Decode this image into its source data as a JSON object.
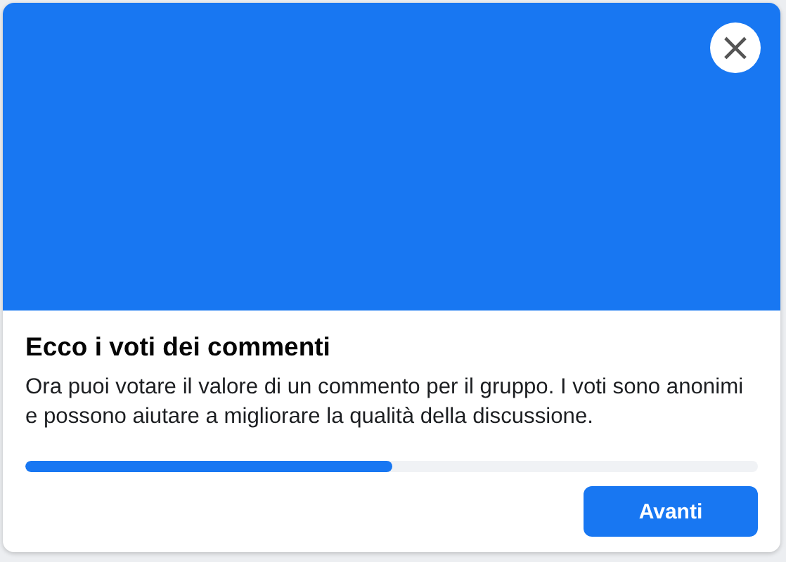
{
  "dialog": {
    "close": "×",
    "title": "Ecco i voti dei commenti",
    "body": "Ora puoi votare il valore di un commento per il gruppo. I voti sono anonimi e possono aiutare a migliorare la qualità della discussione.",
    "progress": {
      "level": 0.5
    },
    "buttons": [
      "Avanti"
    ]
  }
}
